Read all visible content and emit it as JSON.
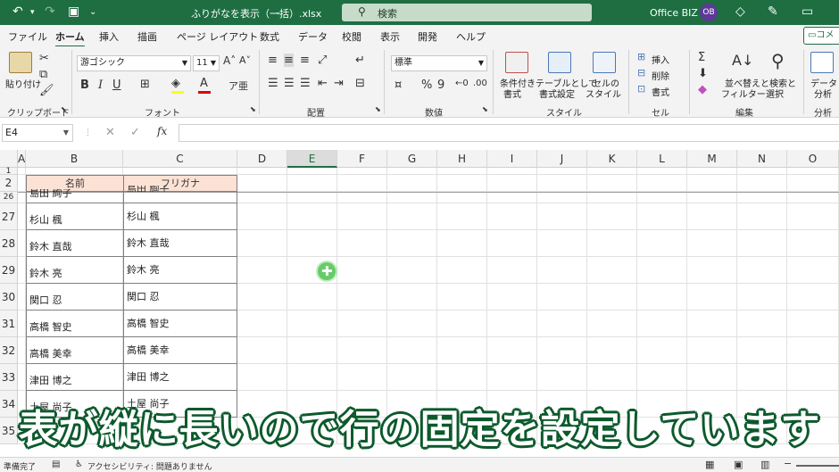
{
  "titlebar": {
    "filename": "ふりがなを表示（一括）.xlsx",
    "search_placeholder": "検索",
    "user_name": "Office BIZ",
    "avatar_initials": "OB"
  },
  "tabs": [
    "ファイル",
    "ホーム",
    "挿入",
    "描画",
    "ページ レイアウト",
    "数式",
    "データ",
    "校閲",
    "表示",
    "開発",
    "ヘルプ"
  ],
  "active_tab": "ホーム",
  "comment_button": "コメント",
  "ribbon": {
    "clipboard": {
      "paste": "貼り付け",
      "label": "クリップボード"
    },
    "font": {
      "font_name": "游ゴシック",
      "font_size": "11",
      "label": "フォント"
    },
    "alignment": {
      "label": "配置"
    },
    "number": {
      "format": "標準",
      "label": "数値"
    },
    "styles": {
      "conditional_1": "条件付き",
      "conditional_2": "書式",
      "table_1": "テーブルとして",
      "table_2": "書式設定",
      "cell_1": "セルの",
      "cell_2": "スタイル",
      "label": "スタイル"
    },
    "cells": {
      "insert": "挿入",
      "delete": "削除",
      "format": "書式",
      "label": "セル"
    },
    "editing": {
      "sort_1": "並べ替えと",
      "sort_2": "フィルター",
      "find_1": "検索と",
      "find_2": "選択",
      "label": "編集"
    },
    "analysis": {
      "data_1": "データ",
      "data_2": "分析",
      "label": "分析"
    }
  },
  "formula_bar": {
    "name_box": "E4",
    "fx": "fx",
    "formula": ""
  },
  "columns": [
    "A",
    "B",
    "C",
    "D",
    "E",
    "F",
    "G",
    "H",
    "I",
    "J",
    "K",
    "L",
    "M",
    "N",
    "O"
  ],
  "selected_column": "E",
  "rows": [
    "1",
    "2",
    "26",
    "27",
    "28",
    "29",
    "30",
    "31",
    "32",
    "33",
    "34",
    "35"
  ],
  "table": {
    "header_name": "名前",
    "header_kana": "フリガナ",
    "partial_name": "島田 絢子",
    "partial_kana": "島田 絢子",
    "entries": [
      {
        "name": "杉山 楓",
        "kana": "杉山 楓"
      },
      {
        "name": "鈴木 直哉",
        "kana": "鈴木 直哉"
      },
      {
        "name": "鈴木 亮",
        "kana": "鈴木 亮"
      },
      {
        "name": "関口 忍",
        "kana": "関口 忍"
      },
      {
        "name": "高橋 智史",
        "kana": "高橋 智史"
      },
      {
        "name": "高橋 美幸",
        "kana": "高橋 美幸"
      },
      {
        "name": "津田 博之",
        "kana": "津田 博之"
      },
      {
        "name": "土屋 尚子",
        "kana": "土屋 尚子"
      }
    ]
  },
  "caption": "表が縦に長いので行の固定を設定しています",
  "status": {
    "ready": "準備完了",
    "accessibility": "アクセシビリティ: 問題ありません"
  },
  "colors": {
    "excel_green": "#1e6e42",
    "header_fill": "#fbe2d5",
    "cursor": "#66cc66"
  }
}
